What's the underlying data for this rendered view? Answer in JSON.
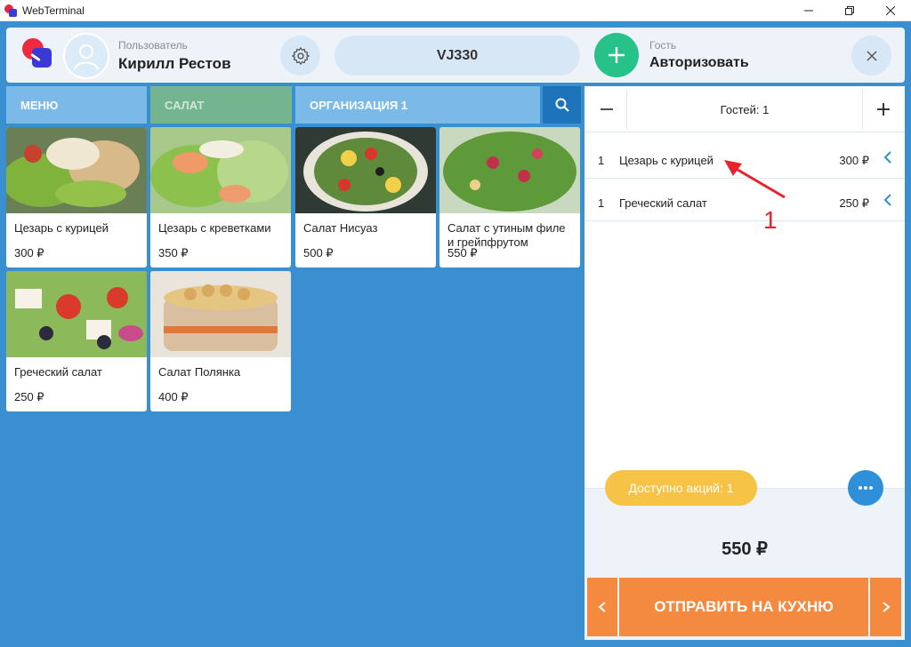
{
  "window": {
    "title": "WebTerminal"
  },
  "header": {
    "user_label": "Пользователь",
    "user_name": "Кирилл Рестов",
    "order_code": "VJ330",
    "guest_label": "Гость",
    "guest_action": "Авторизовать"
  },
  "breadcrumbs": {
    "menu": "МЕНЮ",
    "category": "САЛАТ",
    "organization": "ОРГАНИЗАЦИЯ 1"
  },
  "products": [
    {
      "name": "Цезарь с курицей",
      "price": "300 ₽"
    },
    {
      "name": "Цезарь с креветками",
      "price": "350 ₽"
    },
    {
      "name": "Салат Нисуаз",
      "price": "500 ₽"
    },
    {
      "name": "Салат с утиным филе и грейпфрутом",
      "price": "550 ₽"
    },
    {
      "name": "Греческий салат",
      "price": "250 ₽"
    },
    {
      "name": "Салат Полянка",
      "price": "400 ₽"
    }
  ],
  "order": {
    "guests": "Гостей: 1",
    "lines": [
      {
        "qty": "1",
        "name": "Цезарь с курицей",
        "price": "300 ₽"
      },
      {
        "qty": "1",
        "name": "Греческий салат",
        "price": "250 ₽"
      }
    ],
    "promo": "Доступно акций: 1",
    "total": "550 ₽",
    "send_label": "ОТПРАВИТЬ НА КУХНЮ"
  },
  "annotation": {
    "label": "1"
  },
  "colors": {
    "accent": "#3a8fd0",
    "send": "#f48a3f",
    "promo": "#f6c346",
    "add_guest": "#27c28a"
  }
}
